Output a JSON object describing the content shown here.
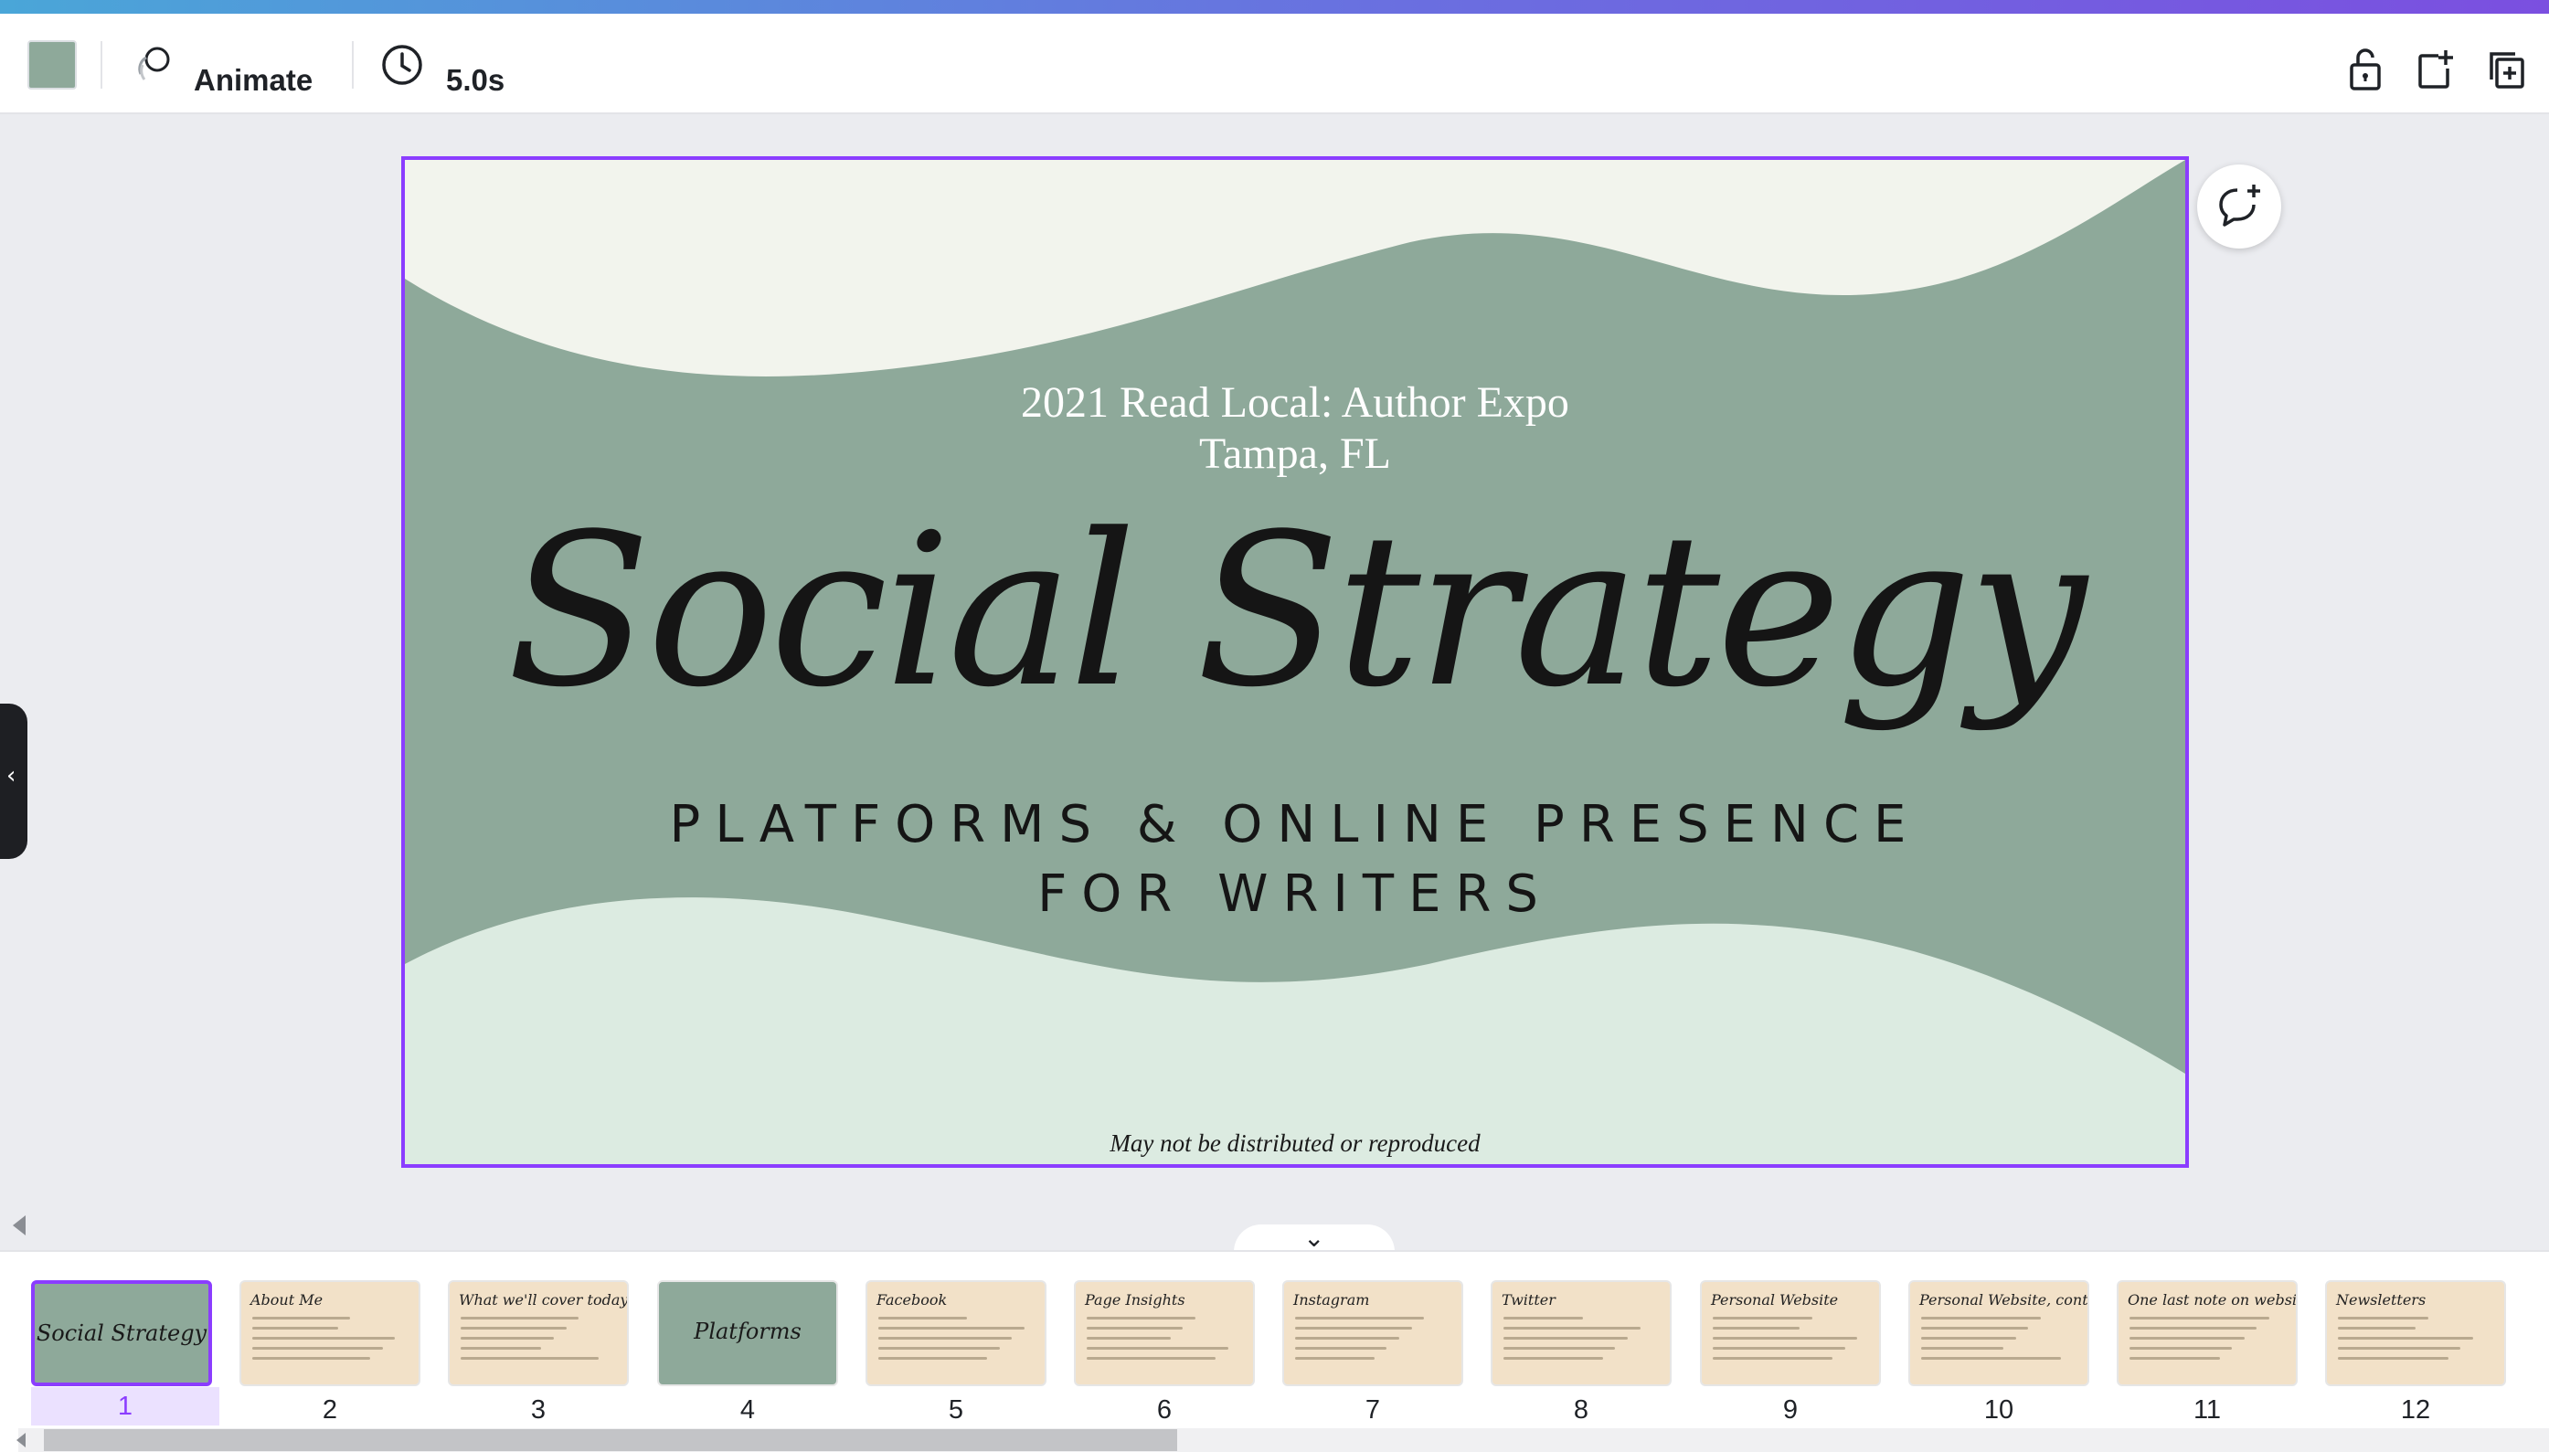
{
  "toolbar": {
    "swatch_color": "#8ea99a",
    "animate_label": "Animate",
    "duration_label": "5.0s",
    "right_icons": [
      "lock-icon",
      "add-page-icon",
      "duplicate-page-icon"
    ]
  },
  "slide": {
    "event_line1": "2021 Read Local: Author Expo",
    "event_line2": "Tampa, FL",
    "title": "Social Strategy",
    "subtitle_line1": "PLATFORMS & ONLINE PRESENCE",
    "subtitle_line2": "FOR WRITERS",
    "footer": "May not be distributed or reproduced",
    "colors": {
      "sage": "#8ea99a",
      "cream": "#f2f4ed",
      "mint": "#dcebe1",
      "selection": "#8b3dff"
    }
  },
  "thumbnails": [
    {
      "number": "1",
      "title": "Social Strategy",
      "style": "sage",
      "active": true
    },
    {
      "number": "2",
      "title": "About Me",
      "style": "cream"
    },
    {
      "number": "3",
      "title": "What we'll cover today",
      "style": "cream"
    },
    {
      "number": "4",
      "title": "Platforms",
      "style": "sage"
    },
    {
      "number": "5",
      "title": "Facebook",
      "style": "cream"
    },
    {
      "number": "6",
      "title": "Page Insights",
      "style": "cream"
    },
    {
      "number": "7",
      "title": "Instagram",
      "style": "cream"
    },
    {
      "number": "8",
      "title": "Twitter",
      "style": "cream"
    },
    {
      "number": "9",
      "title": "Personal Website",
      "style": "cream"
    },
    {
      "number": "10",
      "title": "Personal Website, cont'd",
      "style": "cream"
    },
    {
      "number": "11",
      "title": "One last note on websites",
      "style": "cream"
    },
    {
      "number": "12",
      "title": "Newsletters",
      "style": "cream"
    }
  ]
}
